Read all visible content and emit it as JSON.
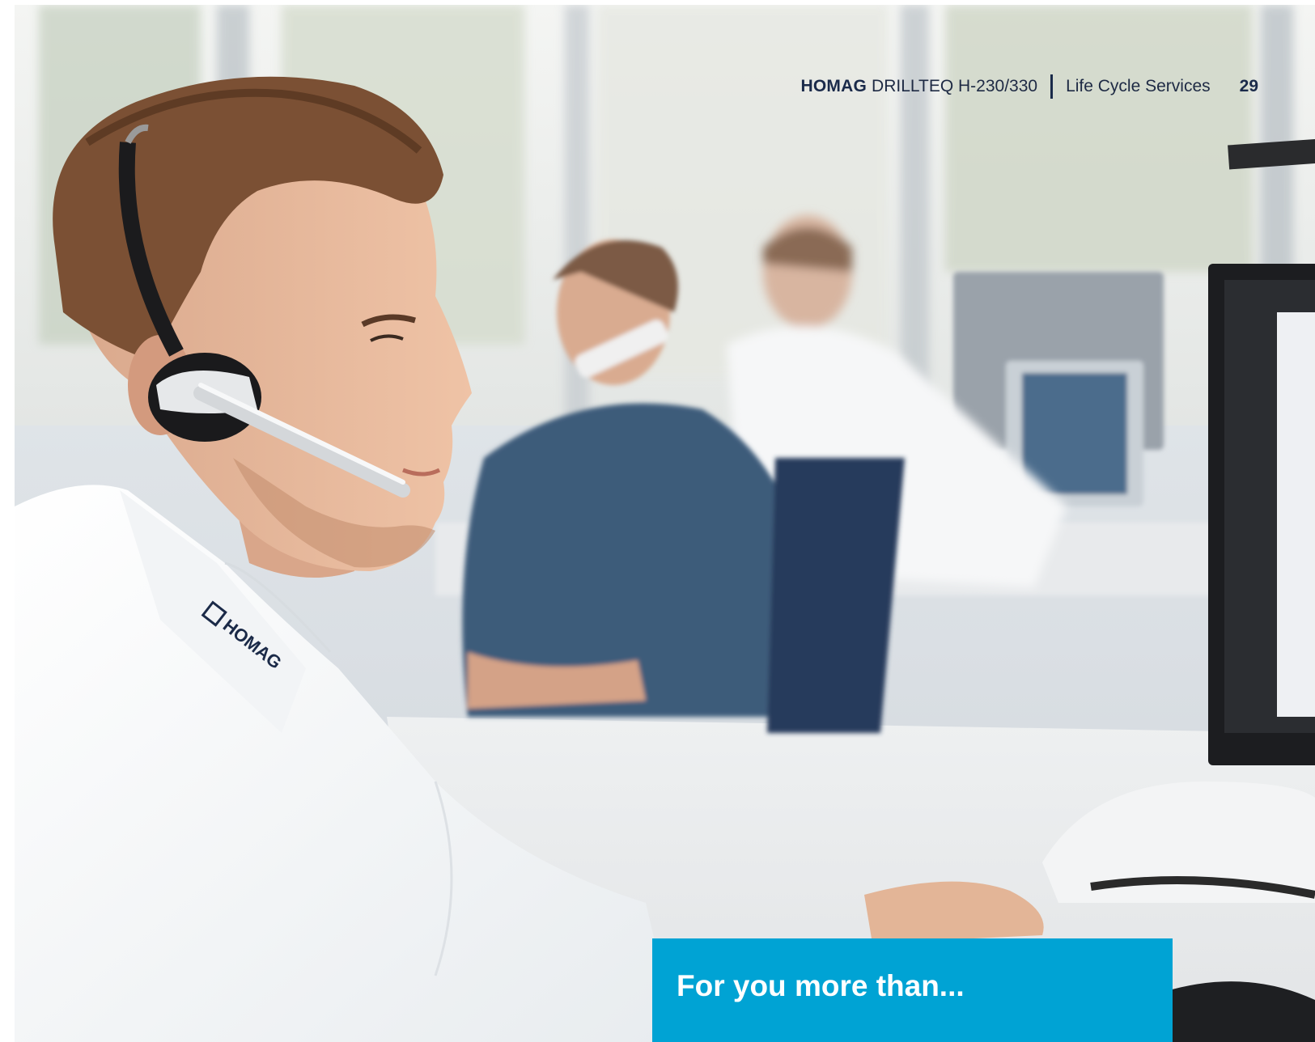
{
  "header": {
    "brand": "HOMAG",
    "product": "DRILLTEQ H-230/330",
    "section": "Life Cycle Services",
    "page_number": "29"
  },
  "photo": {
    "collar_logo": "HOMAG"
  },
  "banner": {
    "text": "For you more than...",
    "color": "#00a3d4"
  }
}
